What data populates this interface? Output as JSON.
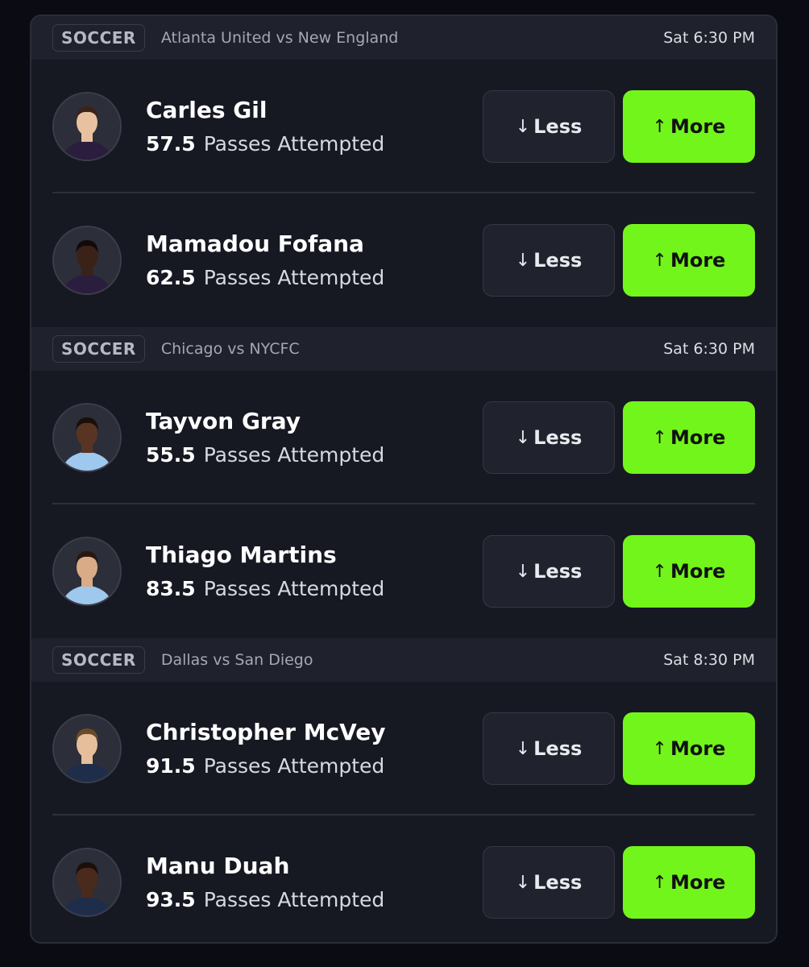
{
  "games": [
    {
      "sport": "SOCCER",
      "matchup": "Atlanta United vs New England",
      "time": "Sat 6:30 PM",
      "players": [
        {
          "name": "Carles Gil",
          "line": "57.5",
          "stat": "Passes Attempted",
          "less": "Less",
          "more": "More",
          "jersey": "#2b1d3d",
          "skin": "#e8c2a0",
          "hair": "#3a2418"
        },
        {
          "name": "Mamadou Fofana",
          "line": "62.5",
          "stat": "Passes Attempted",
          "less": "Less",
          "more": "More",
          "jersey": "#2b1d3d",
          "skin": "#3a2218",
          "hair": "#120a08"
        }
      ]
    },
    {
      "sport": "SOCCER",
      "matchup": "Chicago vs NYCFC",
      "time": "Sat 6:30 PM",
      "players": [
        {
          "name": "Tayvon Gray",
          "line": "55.5",
          "stat": "Passes Attempted",
          "less": "Less",
          "more": "More",
          "jersey": "#9ec8ee",
          "skin": "#5a3423",
          "hair": "#1a0f0a"
        },
        {
          "name": "Thiago Martins",
          "line": "83.5",
          "stat": "Passes Attempted",
          "less": "Less",
          "more": "More",
          "jersey": "#9ec8ee",
          "skin": "#d9ab86",
          "hair": "#2a1810"
        }
      ]
    },
    {
      "sport": "SOCCER",
      "matchup": "Dallas vs San Diego",
      "time": "Sat 8:30 PM",
      "players": [
        {
          "name": "Christopher McVey",
          "line": "91.5",
          "stat": "Passes Attempted",
          "less": "Less",
          "more": "More",
          "jersey": "#1e2e4a",
          "skin": "#e6be9c",
          "hair": "#6b4a2a"
        },
        {
          "name": "Manu Duah",
          "line": "93.5",
          "stat": "Passes Attempted",
          "less": "Less",
          "more": "More",
          "jersey": "#1e2e4a",
          "skin": "#4a2a1c",
          "hair": "#1a0f0a"
        }
      ]
    }
  ],
  "colors": {
    "more_accent": "#72f51b",
    "background": "#0b0c13",
    "card": "#161822"
  },
  "icons": {
    "less": "arrow-down-icon",
    "more": "arrow-up-icon"
  }
}
